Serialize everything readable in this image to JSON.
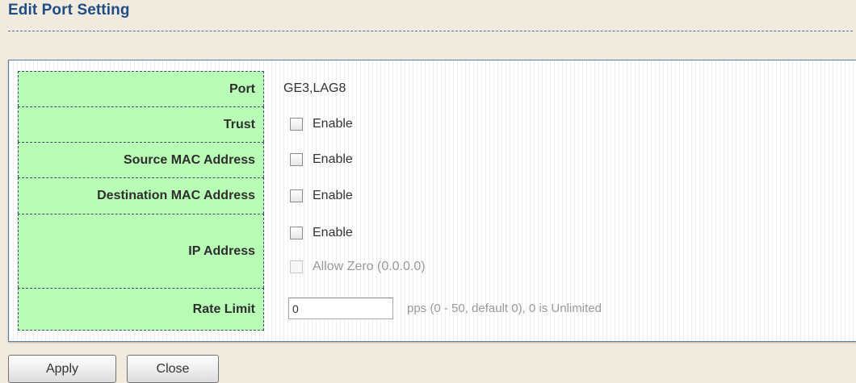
{
  "title": "Edit Port Setting",
  "rows": {
    "port": {
      "label": "Port",
      "value": "GE3,LAG8"
    },
    "trust": {
      "label": "Trust",
      "checkbox_label": "Enable",
      "checked": false
    },
    "source_mac": {
      "label": "Source MAC Address",
      "checkbox_label": "Enable",
      "checked": false
    },
    "destination_mac": {
      "label": "Destination MAC Address",
      "checkbox_label": "Enable",
      "checked": false
    },
    "ip_address": {
      "label": "IP Address",
      "enable_label": "Enable",
      "enable_checked": false,
      "allow_zero_label": "Allow Zero (0.0.0.0)",
      "allow_zero_checked": false,
      "allow_zero_disabled": true
    },
    "rate_limit": {
      "label": "Rate Limit",
      "value": "0",
      "hint": "pps (0 - 50, default 0), 0 is Unlimited"
    }
  },
  "buttons": {
    "apply": "Apply",
    "close": "Close"
  },
  "colors": {
    "title": "#1f4d86",
    "label_bg": "#b9fcb6",
    "page_bg": "#f1ebdf"
  }
}
